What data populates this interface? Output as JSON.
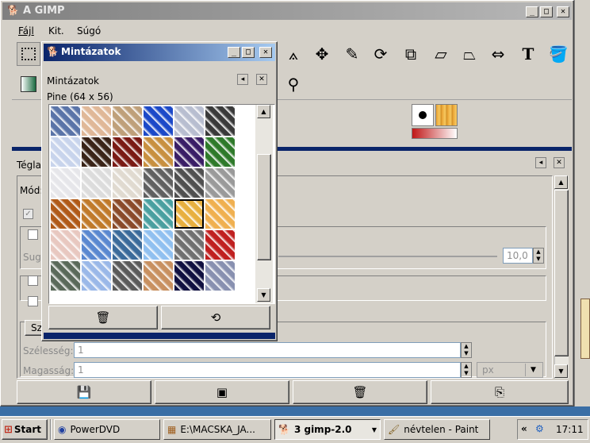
{
  "main_window": {
    "title": "A GIMP",
    "menu": [
      "Fájl",
      "Kit.",
      "Súgó"
    ]
  },
  "tool_options": {
    "title": "Téglal",
    "mode_label": "Mód:",
    "radius_label": "Sugá",
    "radius_value": "10,0",
    "size_button": "Sz",
    "width_label": "Szélesség:",
    "width_value": "1",
    "height_label": "Magasság:",
    "height_value": "1",
    "unit": "px"
  },
  "patterns_window": {
    "title": "Mintázatok",
    "panel_title": "Mintázatok",
    "selected_name": "Pine (64 x 56)"
  },
  "patterns": [
    "#5a74a8",
    "#e0b898",
    "#bfa07a",
    "#1c49c8",
    "#b8bed0",
    "#3a3a3a",
    "#c8d4ec",
    "#3a2418",
    "#7a1a14",
    "#c89040",
    "#3a1e66",
    "#2e7a2a",
    "#e6e6ea",
    "#dcdcdc",
    "#e0dad0",
    "#606060",
    "#505050",
    "#9a9a9a",
    "#b05a18",
    "#c07a2a",
    "#8a4a2a",
    "#4aa0a0",
    "#e8b040",
    "#f0b050",
    "#e8c8c0",
    "#5a88d0",
    "#3a6a9a",
    "#90c0f0",
    "#707070",
    "#c02020",
    "#5a6a5a",
    "#9ab8e8",
    "#5a5a5a",
    "#c89060",
    "#101040",
    "#8890b0"
  ],
  "taskbar": {
    "start": "Start",
    "items": [
      "PowerDVD",
      "E:\\MACSKA_JA...",
      "3 gimp-2.0",
      "névtelen - Paint"
    ],
    "clock": "17:11"
  },
  "colors": {
    "title_active": "#0a246a",
    "title_inactive": "#808080",
    "face": "#d4d0c8",
    "desktop": "#3a6ea5"
  }
}
